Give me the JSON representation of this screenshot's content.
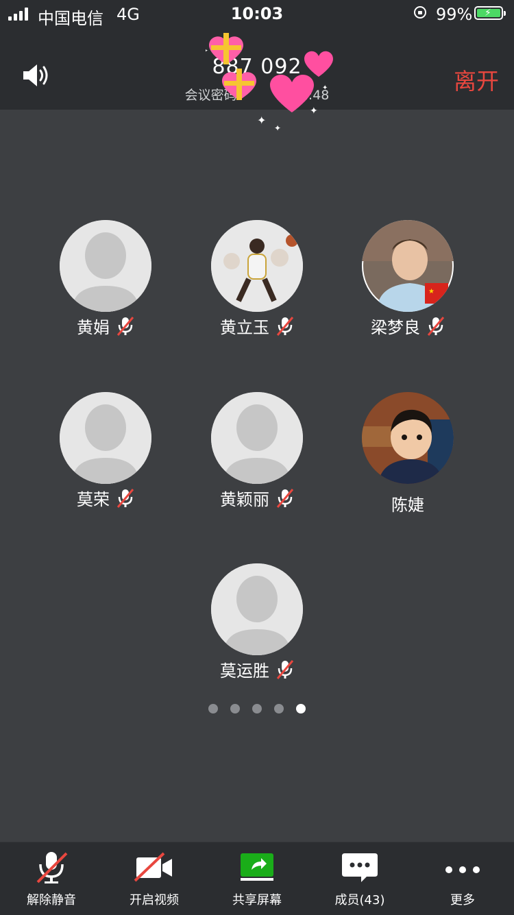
{
  "status_bar": {
    "carrier": "中国电信",
    "network": "4G",
    "time": "10:03",
    "battery_percent": "99%",
    "battery_level": 0.99,
    "battery_color": "#4cd964"
  },
  "meeting": {
    "id": "887 092",
    "subtitle_prefix": "会议密码",
    "elapsed": "2:48",
    "leave_label": "离开",
    "leave_color": "#e8473f",
    "speaker_icon": "speaker-icon"
  },
  "participants": [
    {
      "name": "黄娟",
      "muted": true,
      "avatar": "default-silhouette"
    },
    {
      "name": "黄立玉",
      "muted": true,
      "avatar": "photo-basketball-player"
    },
    {
      "name": "梁梦良",
      "muted": true,
      "avatar": "photo-boy-smiling"
    },
    {
      "name": "莫荣",
      "muted": true,
      "avatar": "default-silhouette"
    },
    {
      "name": "黄颖丽",
      "muted": true,
      "avatar": "default-silhouette"
    },
    {
      "name": "陈婕",
      "muted": false,
      "avatar": "photo-child"
    },
    {
      "name": "莫运胜",
      "muted": true,
      "avatar": "default-silhouette"
    }
  ],
  "pagination": {
    "total": 5,
    "current": 5
  },
  "toolbar": {
    "unmute_label": "解除静音",
    "video_label": "开启视频",
    "share_label": "共享屏幕",
    "members_label": "成员(43)",
    "more_label": "更多",
    "share_color": "#1aad19"
  }
}
